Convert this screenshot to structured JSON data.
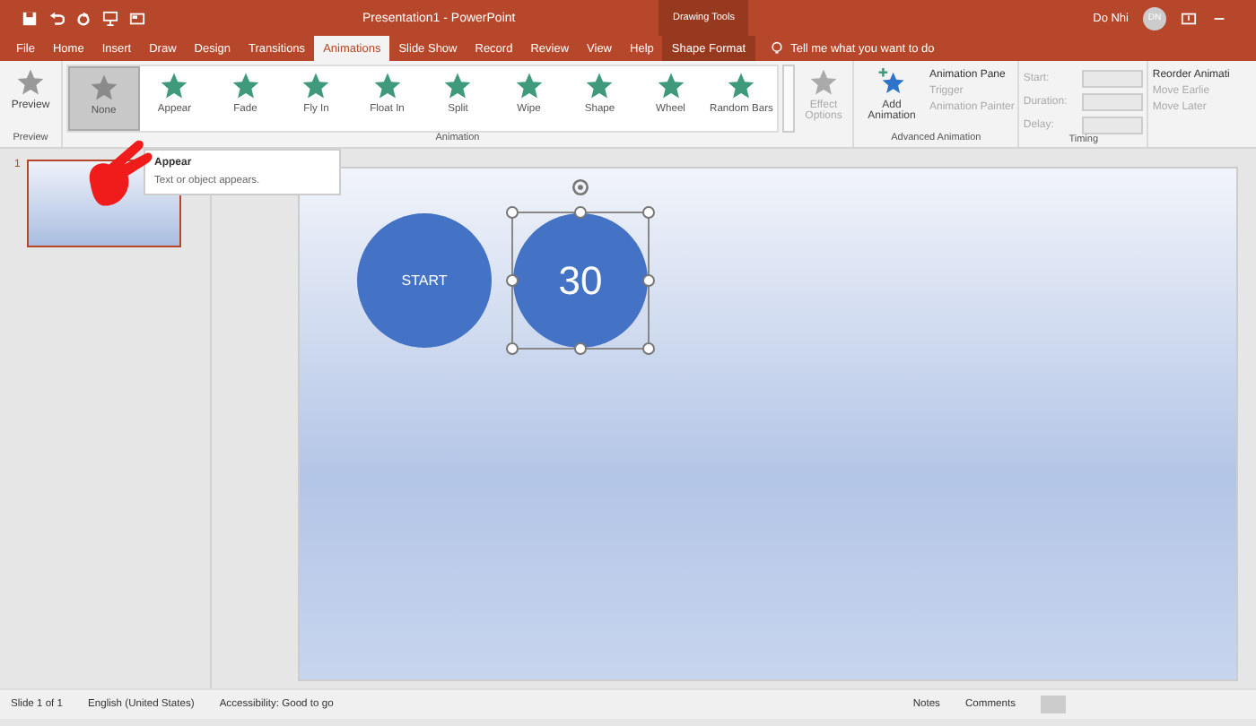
{
  "title_bar": {
    "title": "Presentation1  -  PowerPoint",
    "context_label": "Drawing Tools",
    "user_name": "Do Nhi",
    "user_initials": "DN"
  },
  "tabs": [
    {
      "label": "File",
      "selected": false,
      "contextual": false
    },
    {
      "label": "Home",
      "selected": false,
      "contextual": false
    },
    {
      "label": "Insert",
      "selected": false,
      "contextual": false
    },
    {
      "label": "Draw",
      "selected": false,
      "contextual": false
    },
    {
      "label": "Design",
      "selected": false,
      "contextual": false
    },
    {
      "label": "Transitions",
      "selected": false,
      "contextual": false
    },
    {
      "label": "Animations",
      "selected": true,
      "contextual": false
    },
    {
      "label": "Slide Show",
      "selected": false,
      "contextual": false
    },
    {
      "label": "Record",
      "selected": false,
      "contextual": false
    },
    {
      "label": "Review",
      "selected": false,
      "contextual": false
    },
    {
      "label": "View",
      "selected": false,
      "contextual": false
    },
    {
      "label": "Help",
      "selected": false,
      "contextual": false
    },
    {
      "label": "Shape Format",
      "selected": false,
      "contextual": true
    }
  ],
  "tell_me": "Tell me what you want to do",
  "ribbon": {
    "preview": {
      "label": "Preview",
      "group": "Preview"
    },
    "gallery": [
      {
        "label": "None",
        "selected": true,
        "kind": "none"
      },
      {
        "label": "Appear",
        "selected": false,
        "kind": "effect"
      },
      {
        "label": "Fade",
        "selected": false,
        "kind": "effect"
      },
      {
        "label": "Fly In",
        "selected": false,
        "kind": "effect"
      },
      {
        "label": "Float In",
        "selected": false,
        "kind": "effect"
      },
      {
        "label": "Split",
        "selected": false,
        "kind": "effect"
      },
      {
        "label": "Wipe",
        "selected": false,
        "kind": "effect"
      },
      {
        "label": "Shape",
        "selected": false,
        "kind": "effect"
      },
      {
        "label": "Wheel",
        "selected": false,
        "kind": "effect"
      },
      {
        "label": "Random Bars",
        "selected": false,
        "kind": "effect"
      }
    ],
    "effect_options": {
      "label": "Effect Options",
      "disabled": true
    },
    "animation_group": "Animation",
    "add_animation": "Add Animation",
    "advanced_items": [
      {
        "label": "Animation Pane",
        "disabled": false
      },
      {
        "label": "Trigger",
        "disabled": true
      },
      {
        "label": "Animation Painter",
        "disabled": true
      }
    ],
    "advanced_group": "Advanced Animation",
    "timing_fields": [
      {
        "label": "Start:",
        "disabled": true
      },
      {
        "label": "Duration:",
        "disabled": true
      },
      {
        "label": "Delay:",
        "disabled": true
      }
    ],
    "timing_group": "Timing",
    "reorder_title": "Reorder Animati",
    "reorder_items": [
      {
        "label": "Move Earlie",
        "disabled": true
      },
      {
        "label": "Move Later",
        "disabled": true
      }
    ]
  },
  "tooltip": {
    "title": "Appear",
    "text": "Text or object appears."
  },
  "thumbnails": [
    {
      "number": "1",
      "selected": true
    }
  ],
  "shapes": [
    {
      "text": "START",
      "selected": false,
      "kind": "caption"
    },
    {
      "text": "30",
      "selected": true,
      "kind": "counter"
    }
  ],
  "status_bar": {
    "left": [
      "Slide 1 of 1",
      "English (United States)",
      "Accessibility: Good to go"
    ],
    "right": [
      "Notes",
      "Comments"
    ]
  }
}
